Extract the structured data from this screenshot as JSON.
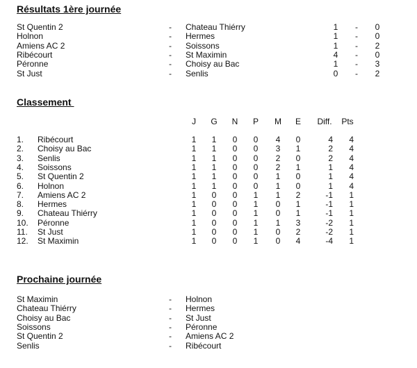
{
  "results": {
    "title": "Résultats 1ère journée",
    "matches": [
      {
        "home": "St Quentin 2",
        "away": "Chateau Thiérry",
        "home_score": "1",
        "away_score": "0"
      },
      {
        "home": "Holnon",
        "away": "Hermes",
        "home_score": "1",
        "away_score": "0"
      },
      {
        "home": "Amiens AC 2",
        "away": "Soissons",
        "home_score": "1",
        "away_score": "2"
      },
      {
        "home": "Ribécourt",
        "away": "St Maximin",
        "home_score": "4",
        "away_score": "0"
      },
      {
        "home": "Péronne",
        "away": "Choisy au Bac",
        "home_score": "1",
        "away_score": "3"
      },
      {
        "home": "St Just",
        "away": "Senlis",
        "home_score": "0",
        "away_score": "2"
      }
    ]
  },
  "standings": {
    "title": "Classement ",
    "headers": {
      "J": "J",
      "G": "G",
      "N": "N",
      "P": "P",
      "M": "M",
      "E": "E",
      "Diff": "Diff.",
      "Pts": "Pts"
    },
    "rows": [
      {
        "rank": "1.",
        "team": "Ribécourt",
        "J": "1",
        "G": "1",
        "N": "0",
        "P": "0",
        "M": "4",
        "E": "0",
        "Diff": "4",
        "Pts": "4"
      },
      {
        "rank": "2.",
        "team": "Choisy au Bac",
        "J": "1",
        "G": "1",
        "N": "0",
        "P": "0",
        "M": "3",
        "E": "1",
        "Diff": "2",
        "Pts": "4"
      },
      {
        "rank": "3.",
        "team": "Senlis",
        "J": "1",
        "G": "1",
        "N": "0",
        "P": "0",
        "M": "2",
        "E": "0",
        "Diff": "2",
        "Pts": "4"
      },
      {
        "rank": "4.",
        "team": "Soissons",
        "J": "1",
        "G": "1",
        "N": "0",
        "P": "0",
        "M": "2",
        "E": "1",
        "Diff": "1",
        "Pts": "4"
      },
      {
        "rank": "5.",
        "team": "St Quentin 2",
        "J": "1",
        "G": "1",
        "N": "0",
        "P": "0",
        "M": "1",
        "E": "0",
        "Diff": "1",
        "Pts": "4"
      },
      {
        "rank": "6.",
        "team": "Holnon",
        "J": "1",
        "G": "1",
        "N": "0",
        "P": "0",
        "M": "1",
        "E": "0",
        "Diff": "1",
        "Pts": "4"
      },
      {
        "rank": "7.",
        "team": "Amiens AC 2",
        "J": "1",
        "G": "0",
        "N": "0",
        "P": "1",
        "M": "1",
        "E": "2",
        "Diff": "-1",
        "Pts": "1"
      },
      {
        "rank": "8.",
        "team": "Hermes",
        "J": "1",
        "G": "0",
        "N": "0",
        "P": "1",
        "M": "0",
        "E": "1",
        "Diff": "-1",
        "Pts": "1"
      },
      {
        "rank": "9.",
        "team": "Chateau Thiérry",
        "J": "1",
        "G": "0",
        "N": "0",
        "P": "1",
        "M": "0",
        "E": "1",
        "Diff": "-1",
        "Pts": "1"
      },
      {
        "rank": "10.",
        "team": "Péronne",
        "J": "1",
        "G": "0",
        "N": "0",
        "P": "1",
        "M": "1",
        "E": "3",
        "Diff": "-2",
        "Pts": "1"
      },
      {
        "rank": "11.",
        "team": "St Just",
        "J": "1",
        "G": "0",
        "N": "0",
        "P": "1",
        "M": "0",
        "E": "2",
        "Diff": "-2",
        "Pts": "1"
      },
      {
        "rank": "12.",
        "team": "St Maximin",
        "J": "1",
        "G": "0",
        "N": "0",
        "P": "1",
        "M": "0",
        "E": "4",
        "Diff": "-4",
        "Pts": "1"
      }
    ]
  },
  "next": {
    "title": "Prochaine journée",
    "matches": [
      {
        "home": "St Maximin",
        "away": "Holnon"
      },
      {
        "home": "Chateau Thiérry",
        "away": "Hermes"
      },
      {
        "home": "Choisy au Bac",
        "away": "St Just"
      },
      {
        "home": "Soissons",
        "away": "Péronne"
      },
      {
        "home": "St Quentin 2",
        "away": "Amiens AC 2"
      },
      {
        "home": "Senlis",
        "away": "Ribécourt"
      }
    ]
  },
  "separator": "-"
}
